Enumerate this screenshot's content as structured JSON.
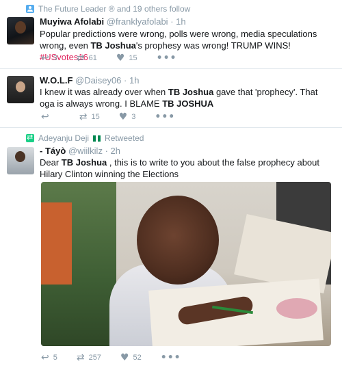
{
  "tweets": [
    {
      "context": "The Future Leader ® and 19 others follow",
      "name": "Muyiwa Afolabi",
      "handle": "@franklyafolabi",
      "time": "1h",
      "text_1": "Popular predictions were wrong, polls were wrong, media speculations wrong, even ",
      "bold_1": "TB Joshua",
      "text_2": "'s prophesy was wrong! TRUMP WINS! ",
      "hashtag": "#USvotes16",
      "replies": "3",
      "retweets": "61",
      "likes": "15"
    },
    {
      "name": "W.O.L.F",
      "handle": "@Daisey06",
      "time": "1h",
      "text_1": "I knew it was already over when ",
      "bold_1": "TB Joshua",
      "text_2": " gave that 'prophecy'. That oga is always wrong. I BLAME ",
      "bold_2": "TB JOSHUA",
      "retweets": "15",
      "likes": "3"
    },
    {
      "context_name": "Adeyanju Deji",
      "context_action": "Retweeted",
      "name": "- Táyò",
      "handle": "@wiilkilz",
      "time": "2h",
      "text_1": "Dear ",
      "bold_1": "TB Joshua",
      "text_2": " , this is to write to you about the false prophecy about Hilary Clinton winning the Elections",
      "replies": "5",
      "retweets": "257",
      "likes": "52"
    }
  ],
  "colors": {
    "meta": "#8899a6",
    "hashtag": "#e0245e",
    "follow_icon": "#55acee",
    "retweet_icon": "#19cf86",
    "flag_green": "#008751"
  },
  "icons": [
    "person-icon",
    "retweet-context-icon",
    "nigeria-flag-icon",
    "reply-icon",
    "retweet-icon",
    "like-icon",
    "more-icon"
  ],
  "dot": "·",
  "more": "•••"
}
